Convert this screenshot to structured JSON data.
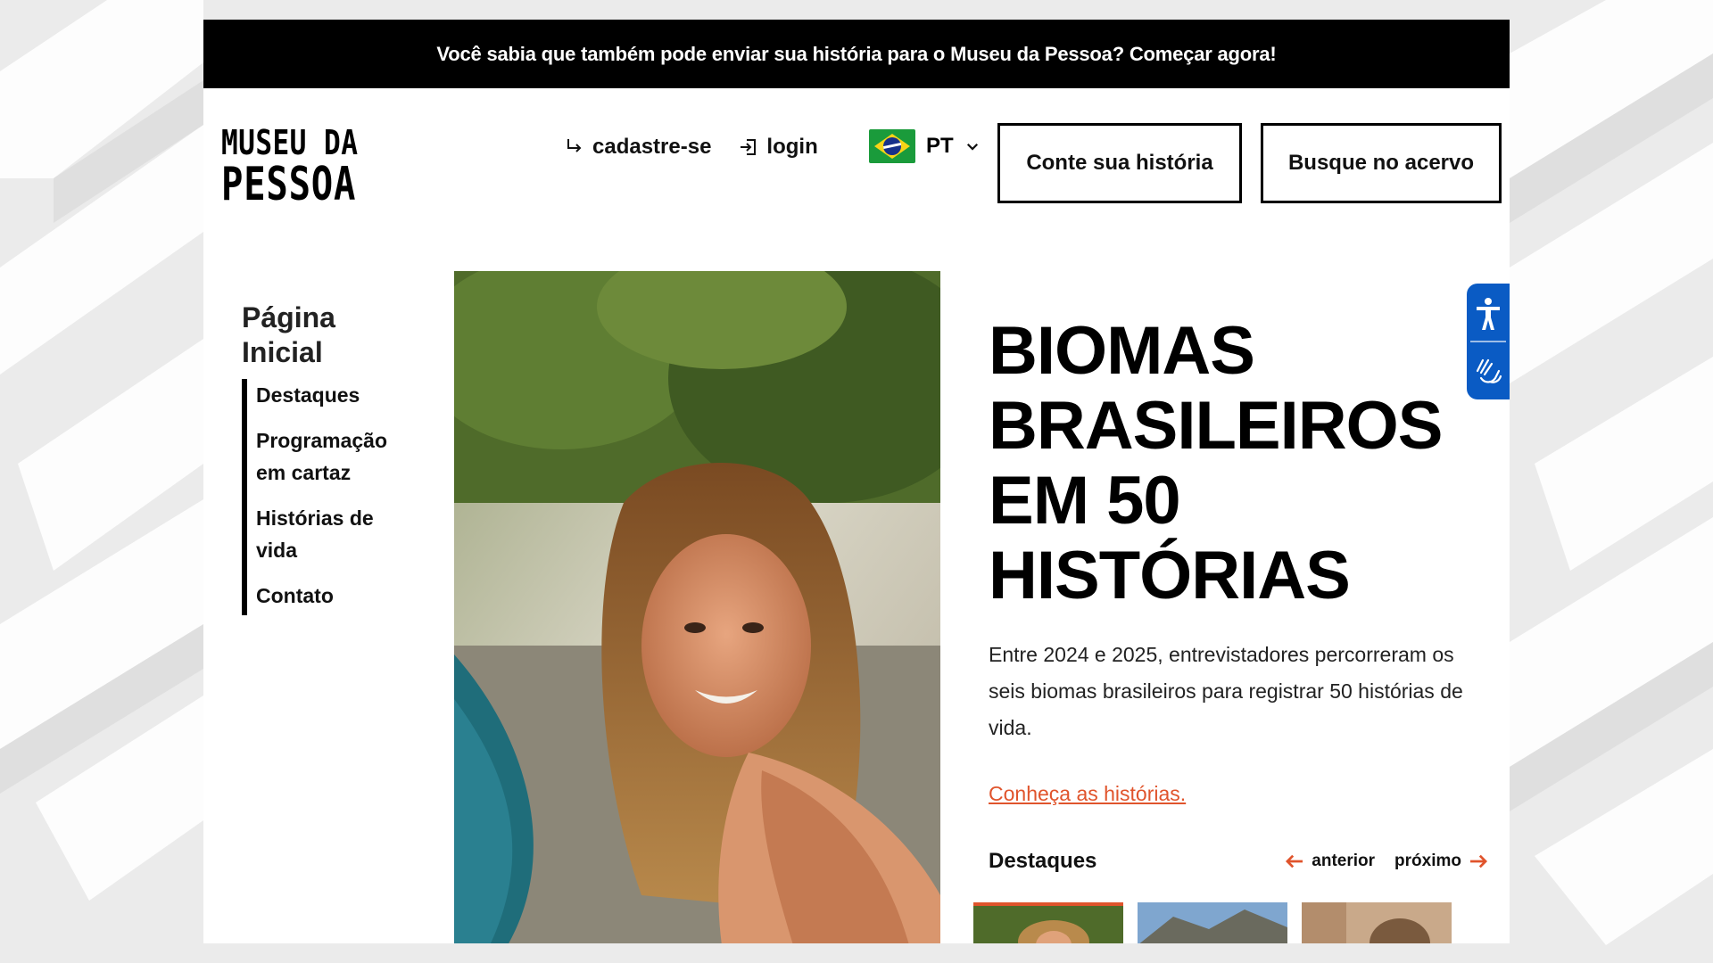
{
  "banner": {
    "text": "Você sabia que também pode enviar sua história para o Museu da Pessoa? Começar agora!"
  },
  "logo": {
    "line1": "MUSEU DA",
    "line2": "PESSOA"
  },
  "header": {
    "register_label": "cadastre-se",
    "login_label": "login",
    "language_code": "PT",
    "tell_story_label": "Conte sua história",
    "search_archive_label": "Busque no acervo"
  },
  "sidebar": {
    "title": "Página Inicial",
    "items": [
      {
        "label": "Destaques"
      },
      {
        "label": "Programação em cartaz"
      },
      {
        "label": "Histórias de vida"
      },
      {
        "label": "Contato"
      }
    ]
  },
  "hero": {
    "title": "BIOMAS BRASILEIROS EM 50 HISTÓRIAS",
    "description": "Entre 2024 e 2025, entrevistadores percorreram os seis biomas brasileiros para registrar 50 histórias de vida.",
    "link_label": "Conheça as histórias."
  },
  "highlights": {
    "title": "Destaques",
    "prev_label": "anterior",
    "next_label": "próximo"
  },
  "colors": {
    "accent": "#e0542c",
    "accessibility_blue": "#0a5bc4",
    "banner_bg": "#000000"
  }
}
